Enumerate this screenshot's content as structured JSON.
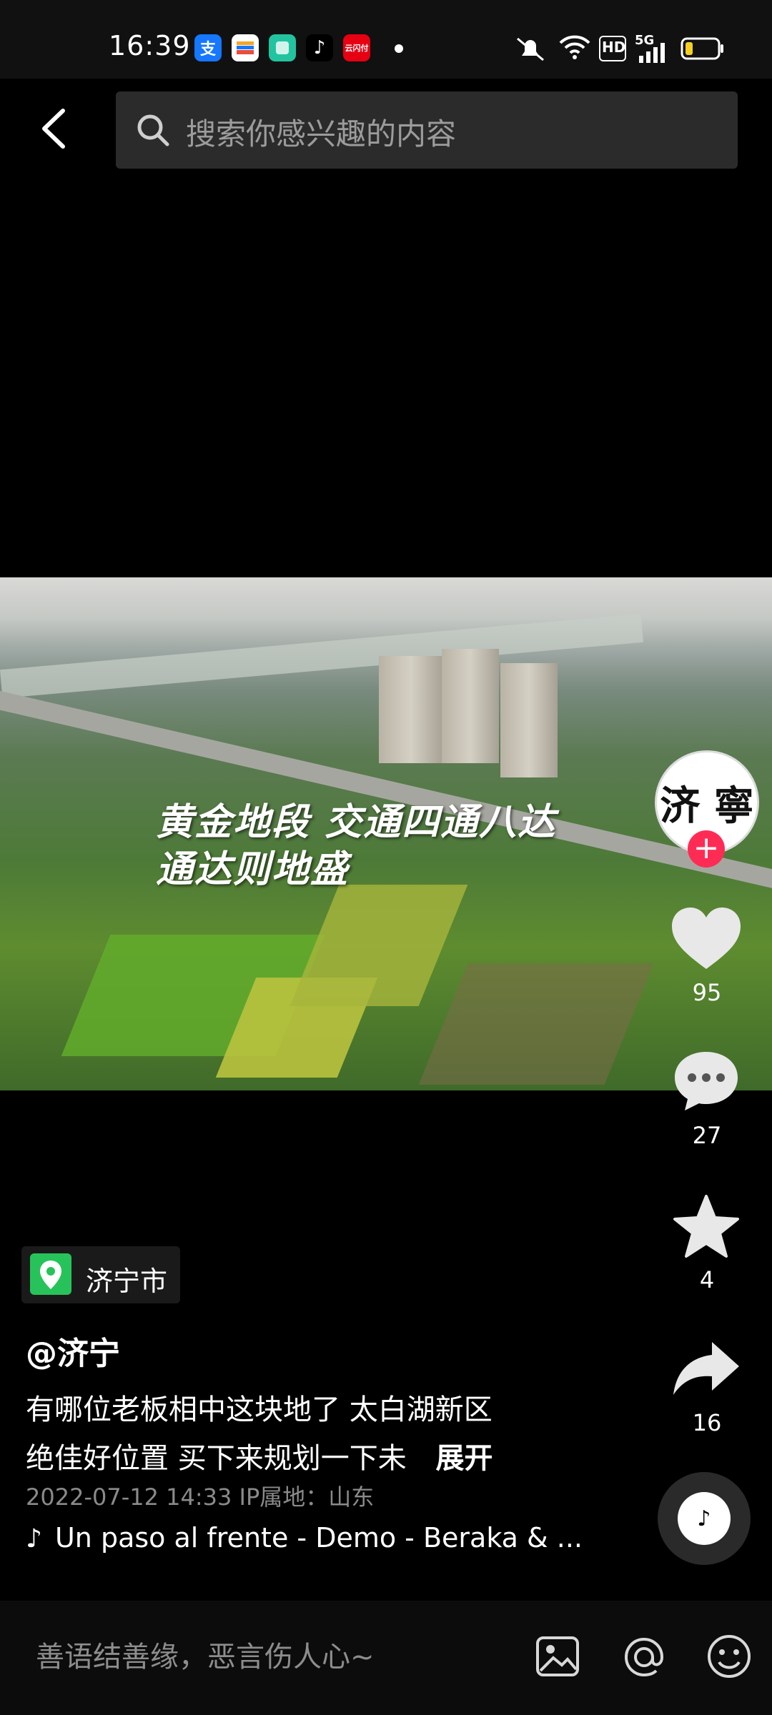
{
  "status_bar": {
    "time": "16:39",
    "apps": [
      {
        "icon": "alipay-icon",
        "glyph": "支",
        "bg": "#1677ff"
      },
      {
        "icon": "wallet-icon",
        "glyph": "",
        "bg": "#ffffff"
      },
      {
        "icon": "app-green-icon",
        "glyph": "",
        "bg": "#22c4a0"
      },
      {
        "icon": "douyin-icon",
        "glyph": "♪",
        "bg": "#000000"
      },
      {
        "icon": "cloud-pay-icon",
        "glyph": "云闪付",
        "bg": "#e60012"
      }
    ],
    "hd_label": "HD",
    "network_label": "5G"
  },
  "search": {
    "placeholder": "搜索你感兴趣的内容"
  },
  "video": {
    "caption_line1": "黄金地段  交通四通八达",
    "caption_line2": "通达则地盛"
  },
  "avatar": {
    "text": "济 寧"
  },
  "actions": {
    "like_count": "95",
    "comment_count": "27",
    "favorite_count": "4",
    "share_count": "16"
  },
  "post": {
    "location": "济宁市",
    "author": "@济宁",
    "desc_line1": "有哪位老板相中这块地了 太白湖新区",
    "desc_line2": "绝佳好位置 买下来规划一下未",
    "expand_label": "展开",
    "meta": "2022-07-12 14:33  IP属地：山东",
    "music": "Un paso al frente - Demo - Beraka & ..."
  },
  "comment_bar": {
    "placeholder": "善语结善缘，恶言伤人心~"
  },
  "colors": {
    "accent_red": "#fe2c55",
    "location_green": "#27c35a"
  }
}
